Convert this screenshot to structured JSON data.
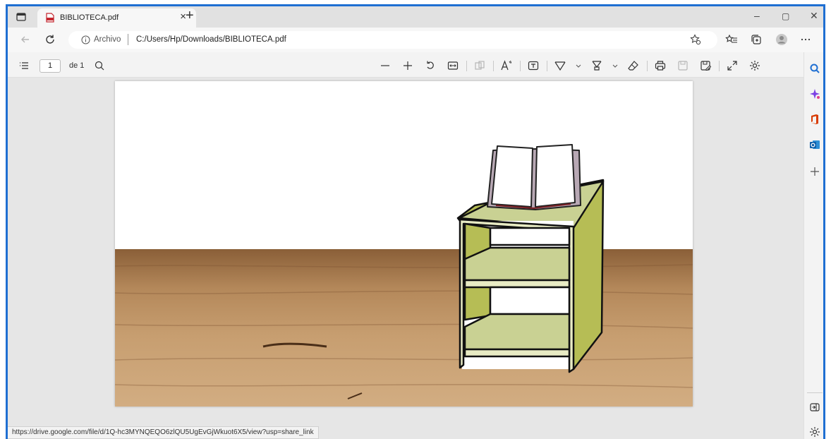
{
  "tab": {
    "title": "BIBLIOTECA.pdf",
    "close": "×",
    "new_tab": "+"
  },
  "window": {
    "minimize": "–",
    "restore": "▢",
    "close": "✕"
  },
  "address": {
    "label": "Archivo",
    "url": "C:/Users/Hp/Downloads/BIBLIOTECA.pdf"
  },
  "pdf_toolbar": {
    "page_value": "1",
    "page_count": "de 1"
  },
  "status_bar": {
    "link": "https://drive.google.com/file/d/1Q-hc3MYNQEQO6zlQU5UgEvGjWkuot6X5/view?usp=share_link"
  },
  "colors": {
    "accent": "#1f6fd2",
    "shelf": "#c9d193",
    "shelf_side": "#b6bd55",
    "wood": "#b88a5a"
  },
  "icons": [
    "tab-actions-icon",
    "pdf-icon",
    "back-icon",
    "refresh-icon",
    "info-icon",
    "favorite-add-icon",
    "favorites-icon",
    "collections-icon",
    "profile-icon",
    "more-icon",
    "contents-icon",
    "search-icon",
    "zoom-out-icon",
    "zoom-in-icon",
    "rotate-icon",
    "fit-page-icon",
    "page-view-icon",
    "read-aloud-icon",
    "text-icon",
    "draw-icon",
    "highlight-icon",
    "erase-icon",
    "print-icon",
    "save-icon",
    "save-as-icon",
    "fullscreen-icon",
    "settings-icon",
    "bing-search-icon",
    "copilot-icon",
    "office-icon",
    "outlook-icon",
    "add-icon",
    "sidebar-toggle-icon"
  ]
}
